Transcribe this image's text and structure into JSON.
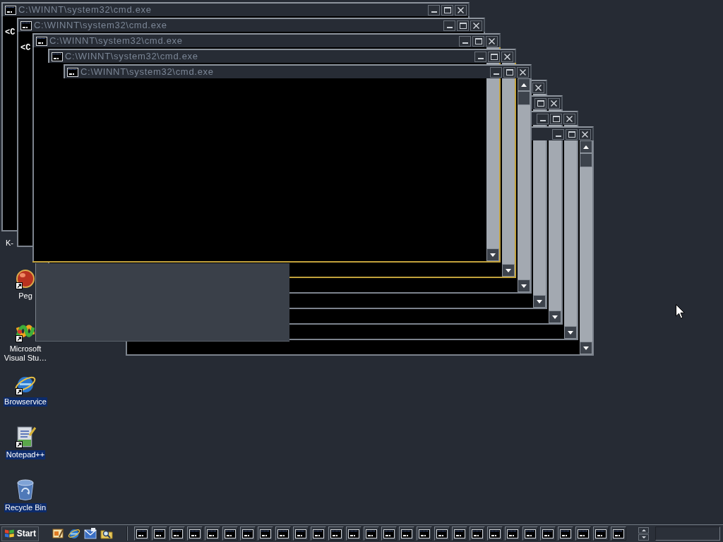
{
  "windows": [
    {
      "title": "C:\\WINNT\\system32\\cmd.exe",
      "active": false,
      "highlighted": false,
      "console_text": "<C"
    },
    {
      "title": "C:\\WINNT\\system32\\cmd.exe",
      "active": false,
      "highlighted": false,
      "console_text": "<C"
    },
    {
      "title": "C:\\WINNT\\system32\\cmd.exe",
      "active": false,
      "highlighted": true
    },
    {
      "title": "C:\\WINNT\\system32\\cmd.exe",
      "active": false,
      "highlighted": true
    },
    {
      "title": "C:\\WINNT\\system32\\cmd.exe",
      "active": false,
      "highlighted": false
    },
    {
      "active": false,
      "highlighted": false
    },
    {
      "active": false,
      "highlighted": false
    },
    {
      "active": false,
      "highlighted": false
    },
    {
      "active": false,
      "highlighted": false
    }
  ],
  "desktop_icons": [
    {
      "label": "K-",
      "kind": "covered",
      "shortcut": false,
      "selected": false
    },
    {
      "label": "Peg",
      "kind": "orb",
      "shortcut": true,
      "selected": false
    },
    {
      "label": "Microsoft Visual Stu…",
      "kind": "ribbon",
      "shortcut": true,
      "selected": false
    },
    {
      "label": "Browservice",
      "kind": "globe",
      "shortcut": true,
      "selected": true
    },
    {
      "label": "Notepad++",
      "kind": "notepad",
      "shortcut": true,
      "selected": true
    },
    {
      "label": "Recycle Bin",
      "kind": "bin",
      "shortcut": false,
      "selected": true
    }
  ],
  "taskbar": {
    "start_button": {
      "label": "Start"
    },
    "quick_launch": [
      {
        "kind": "desktop"
      },
      {
        "kind": "browser"
      },
      {
        "kind": "mail"
      },
      {
        "kind": "search"
      }
    ],
    "buttons": [
      {
        "selected": false
      },
      {
        "selected": false
      },
      {
        "selected": false
      },
      {
        "selected": false
      },
      {
        "selected": false
      },
      {
        "selected": false
      },
      {
        "selected": false
      },
      {
        "selected": false
      },
      {
        "selected": false
      },
      {
        "selected": false
      },
      {
        "selected": false
      },
      {
        "selected": false
      },
      {
        "selected": false
      },
      {
        "selected": false
      },
      {
        "selected": false
      },
      {
        "selected": false
      },
      {
        "selected": false
      },
      {
        "selected": false
      },
      {
        "selected": false
      },
      {
        "selected": false
      },
      {
        "selected": false
      },
      {
        "selected": false
      },
      {
        "selected": false
      },
      {
        "selected": false
      },
      {
        "selected": false
      },
      {
        "selected": false
      },
      {
        "selected": false
      },
      {
        "selected": false
      }
    ]
  }
}
